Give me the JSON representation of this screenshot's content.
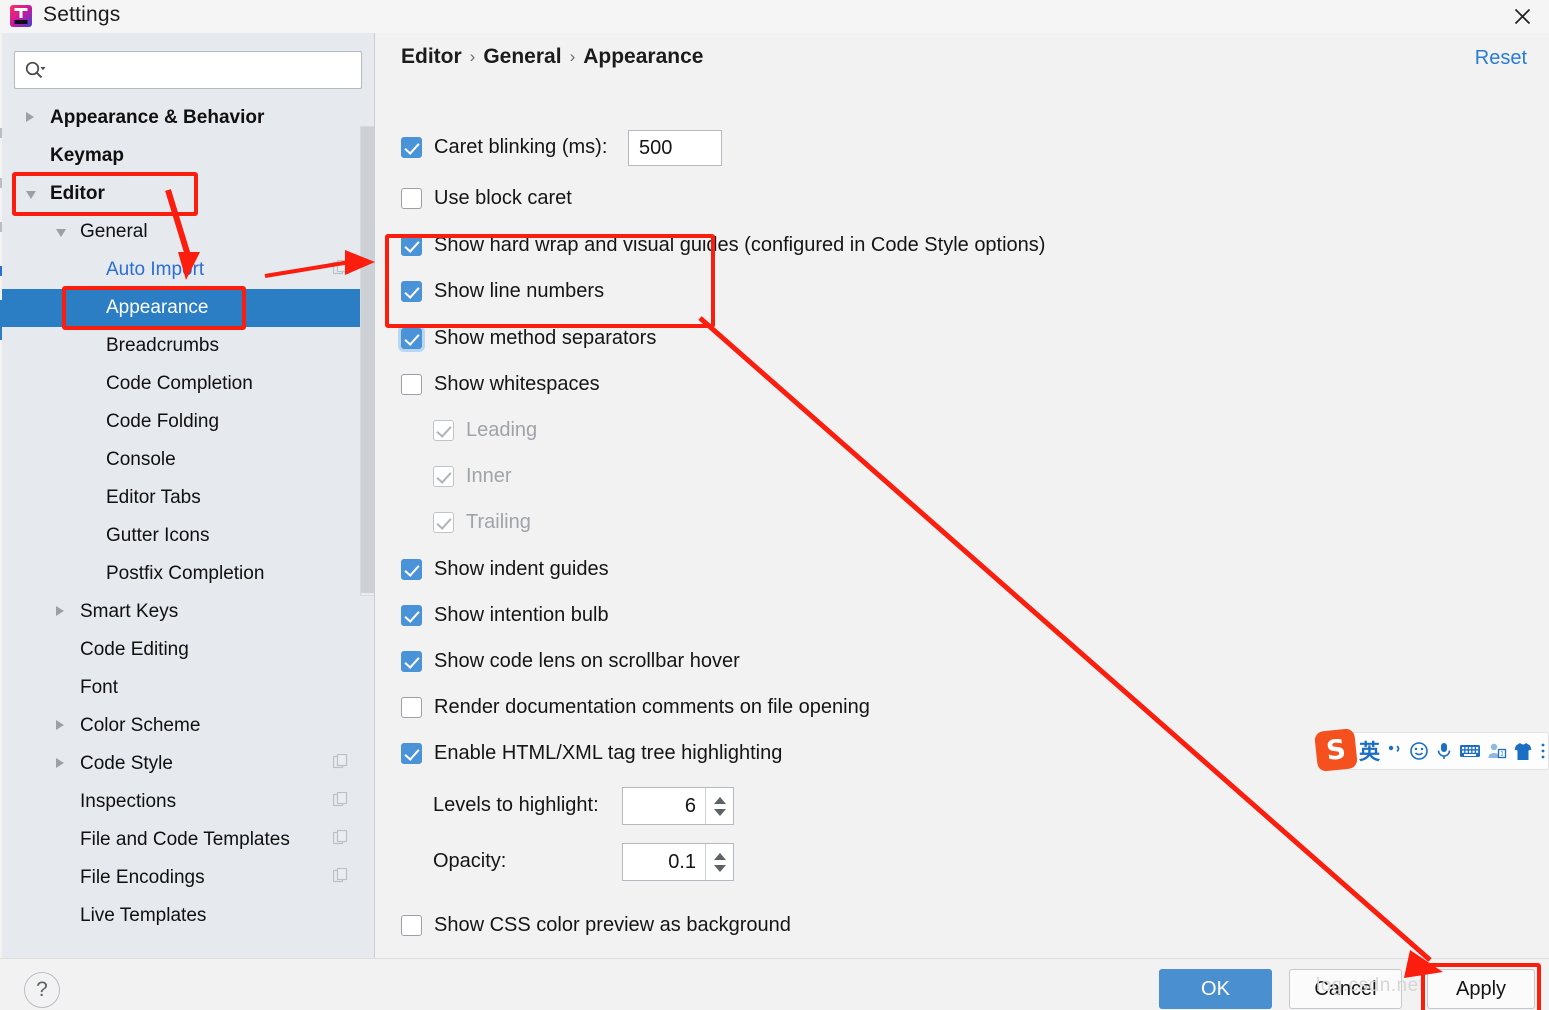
{
  "window": {
    "title": "Settings",
    "app_icon": "intellij-idea-icon",
    "close_icon": "close-icon"
  },
  "search": {
    "value": "",
    "placeholder": "",
    "icon": "search-icon"
  },
  "sidebar": {
    "items": [
      {
        "label": "Appearance & Behavior",
        "indent": 0,
        "twisty": "closed",
        "bold": true,
        "selected": false,
        "link": false,
        "badge": false
      },
      {
        "label": "Keymap",
        "indent": 0,
        "twisty": "none",
        "bold": true,
        "selected": false,
        "link": false,
        "badge": false
      },
      {
        "label": "Editor",
        "indent": 0,
        "twisty": "open",
        "bold": true,
        "selected": false,
        "link": false,
        "badge": false
      },
      {
        "label": "General",
        "indent": 1,
        "twisty": "open",
        "bold": false,
        "selected": false,
        "link": false,
        "badge": false
      },
      {
        "label": "Auto Import",
        "indent": 2,
        "twisty": "none",
        "bold": false,
        "selected": false,
        "link": true,
        "badge": true
      },
      {
        "label": "Appearance",
        "indent": 2,
        "twisty": "none",
        "bold": false,
        "selected": true,
        "link": false,
        "badge": false
      },
      {
        "label": "Breadcrumbs",
        "indent": 2,
        "twisty": "none",
        "bold": false,
        "selected": false,
        "link": false,
        "badge": false
      },
      {
        "label": "Code Completion",
        "indent": 2,
        "twisty": "none",
        "bold": false,
        "selected": false,
        "link": false,
        "badge": false
      },
      {
        "label": "Code Folding",
        "indent": 2,
        "twisty": "none",
        "bold": false,
        "selected": false,
        "link": false,
        "badge": false
      },
      {
        "label": "Console",
        "indent": 2,
        "twisty": "none",
        "bold": false,
        "selected": false,
        "link": false,
        "badge": false
      },
      {
        "label": "Editor Tabs",
        "indent": 2,
        "twisty": "none",
        "bold": false,
        "selected": false,
        "link": false,
        "badge": false
      },
      {
        "label": "Gutter Icons",
        "indent": 2,
        "twisty": "none",
        "bold": false,
        "selected": false,
        "link": false,
        "badge": false
      },
      {
        "label": "Postfix Completion",
        "indent": 2,
        "twisty": "none",
        "bold": false,
        "selected": false,
        "link": false,
        "badge": false
      },
      {
        "label": "Smart Keys",
        "indent": 1,
        "twisty": "closed",
        "bold": false,
        "selected": false,
        "link": false,
        "badge": false
      },
      {
        "label": "Code Editing",
        "indent": 1,
        "twisty": "none",
        "bold": false,
        "selected": false,
        "link": false,
        "badge": false
      },
      {
        "label": "Font",
        "indent": 1,
        "twisty": "none",
        "bold": false,
        "selected": false,
        "link": false,
        "badge": false
      },
      {
        "label": "Color Scheme",
        "indent": 1,
        "twisty": "closed",
        "bold": false,
        "selected": false,
        "link": false,
        "badge": false
      },
      {
        "label": "Code Style",
        "indent": 1,
        "twisty": "closed",
        "bold": false,
        "selected": false,
        "link": false,
        "badge": true
      },
      {
        "label": "Inspections",
        "indent": 1,
        "twisty": "none",
        "bold": false,
        "selected": false,
        "link": false,
        "badge": true
      },
      {
        "label": "File and Code Templates",
        "indent": 1,
        "twisty": "none",
        "bold": false,
        "selected": false,
        "link": false,
        "badge": true
      },
      {
        "label": "File Encodings",
        "indent": 1,
        "twisty": "none",
        "bold": false,
        "selected": false,
        "link": false,
        "badge": true
      },
      {
        "label": "Live Templates",
        "indent": 1,
        "twisty": "none",
        "bold": false,
        "selected": false,
        "link": false,
        "badge": false
      }
    ]
  },
  "breadcrumb": {
    "parts": [
      "Editor",
      "General",
      "Appearance"
    ],
    "separator": "›"
  },
  "header": {
    "reset_label": "Reset"
  },
  "options": [
    {
      "label": "Caret blinking (ms):",
      "state": "checked",
      "focused": false,
      "muted": false
    },
    {
      "label": "Use block caret",
      "state": "unchecked",
      "focused": false,
      "muted": false
    },
    {
      "label": "Show hard wrap and visual guides (configured in Code Style options)",
      "state": "checked",
      "focused": false,
      "muted": false
    },
    {
      "label": "Show line numbers",
      "state": "checked",
      "focused": false,
      "muted": false
    },
    {
      "label": "Show method separators",
      "state": "checked",
      "focused": true,
      "muted": false
    },
    {
      "label": "Show whitespaces",
      "state": "unchecked",
      "focused": false,
      "muted": false
    },
    {
      "label": "Leading",
      "state": "disabled-checked",
      "focused": false,
      "muted": true
    },
    {
      "label": "Inner",
      "state": "disabled-checked",
      "focused": false,
      "muted": true
    },
    {
      "label": "Trailing",
      "state": "disabled-checked",
      "focused": false,
      "muted": true
    },
    {
      "label": "Show indent guides",
      "state": "checked",
      "focused": false,
      "muted": false
    },
    {
      "label": "Show intention bulb",
      "state": "checked",
      "focused": false,
      "muted": false
    },
    {
      "label": "Show code lens on scrollbar hover",
      "state": "checked",
      "focused": false,
      "muted": false
    },
    {
      "label": "Render documentation comments on file opening",
      "state": "unchecked",
      "focused": false,
      "muted": false
    },
    {
      "label": "Enable HTML/XML tag tree highlighting",
      "state": "checked",
      "focused": false,
      "muted": false
    },
    {
      "label": "Show CSS color preview as background",
      "state": "unchecked",
      "focused": false,
      "muted": false
    }
  ],
  "fields": {
    "caret_blinking_value": "500",
    "levels_label": "Levels to highlight:",
    "levels_value": "6",
    "opacity_label": "Opacity:",
    "opacity_value": "0.1"
  },
  "footer": {
    "help_label": "?",
    "ok_label": "OK",
    "cancel_label": "Cancel",
    "apply_label": "Apply"
  },
  "ime": {
    "mode_label": "英",
    "items": [
      "punctuation-icon",
      "emoji-icon",
      "microphone-icon",
      "keyboard-icon",
      "user-icon",
      "skin-icon",
      "menu-icon"
    ]
  },
  "watermarks": {
    "right": "log.csdn.net",
    "left": ""
  },
  "colors": {
    "accent": "#2b7dc4",
    "selection": "#2b7dc4",
    "annotation": "#fb1d0d",
    "link": "#2a7bd4",
    "checkbox_on": "#4a93d9",
    "sidebar_bg": "#e6eaee",
    "panel_bg": "#f2f2f2"
  }
}
